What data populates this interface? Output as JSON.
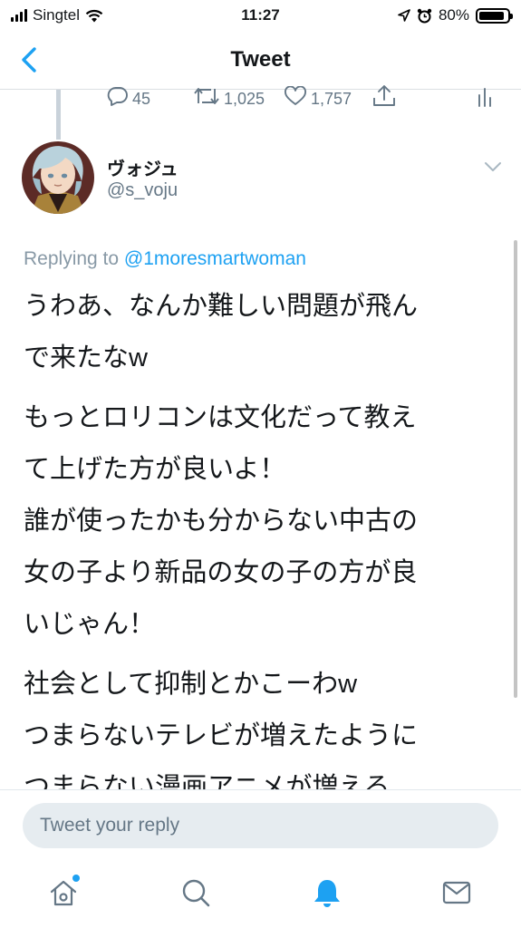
{
  "status_bar": {
    "carrier": "Singtel",
    "time": "11:27",
    "battery": "80%"
  },
  "nav": {
    "title": "Tweet"
  },
  "previous_tweet_actions": {
    "replies": "45",
    "retweets": "1,025",
    "likes": "1,757"
  },
  "tweet": {
    "display_name": "ヴォジュ",
    "handle": "@s_voju",
    "replying_prefix": "Replying to",
    "replying_to": "@1moresmartwoman",
    "paragraphs": [
      "うわあ、なんか難しい問題が飛ん\nで来たなw",
      "もっとロリコンは文化だって教え\nて上げた方が良いよ！\n誰が使ったかも分からない中古の\n女の子より新品の女の子の方が良\nいじゃん！",
      "社会として抑制とかこーわw\nつまらないテレビが増えたように\nつまらない漫画アニメが増える\nぜ！って技術の面で増えてるけどw"
    ]
  },
  "reply": {
    "placeholder": "Tweet your reply"
  },
  "colors": {
    "accent": "#1da1f2",
    "secondary_text": "#657786",
    "input_bg": "#e6ecf0"
  },
  "icons": {
    "tabs": [
      "home-icon",
      "search-icon",
      "notifications-bell-icon",
      "messages-envelope-icon"
    ],
    "actions": [
      "reply-icon",
      "retweet-icon",
      "like-heart-icon",
      "share-icon",
      "analytics-icon"
    ]
  }
}
